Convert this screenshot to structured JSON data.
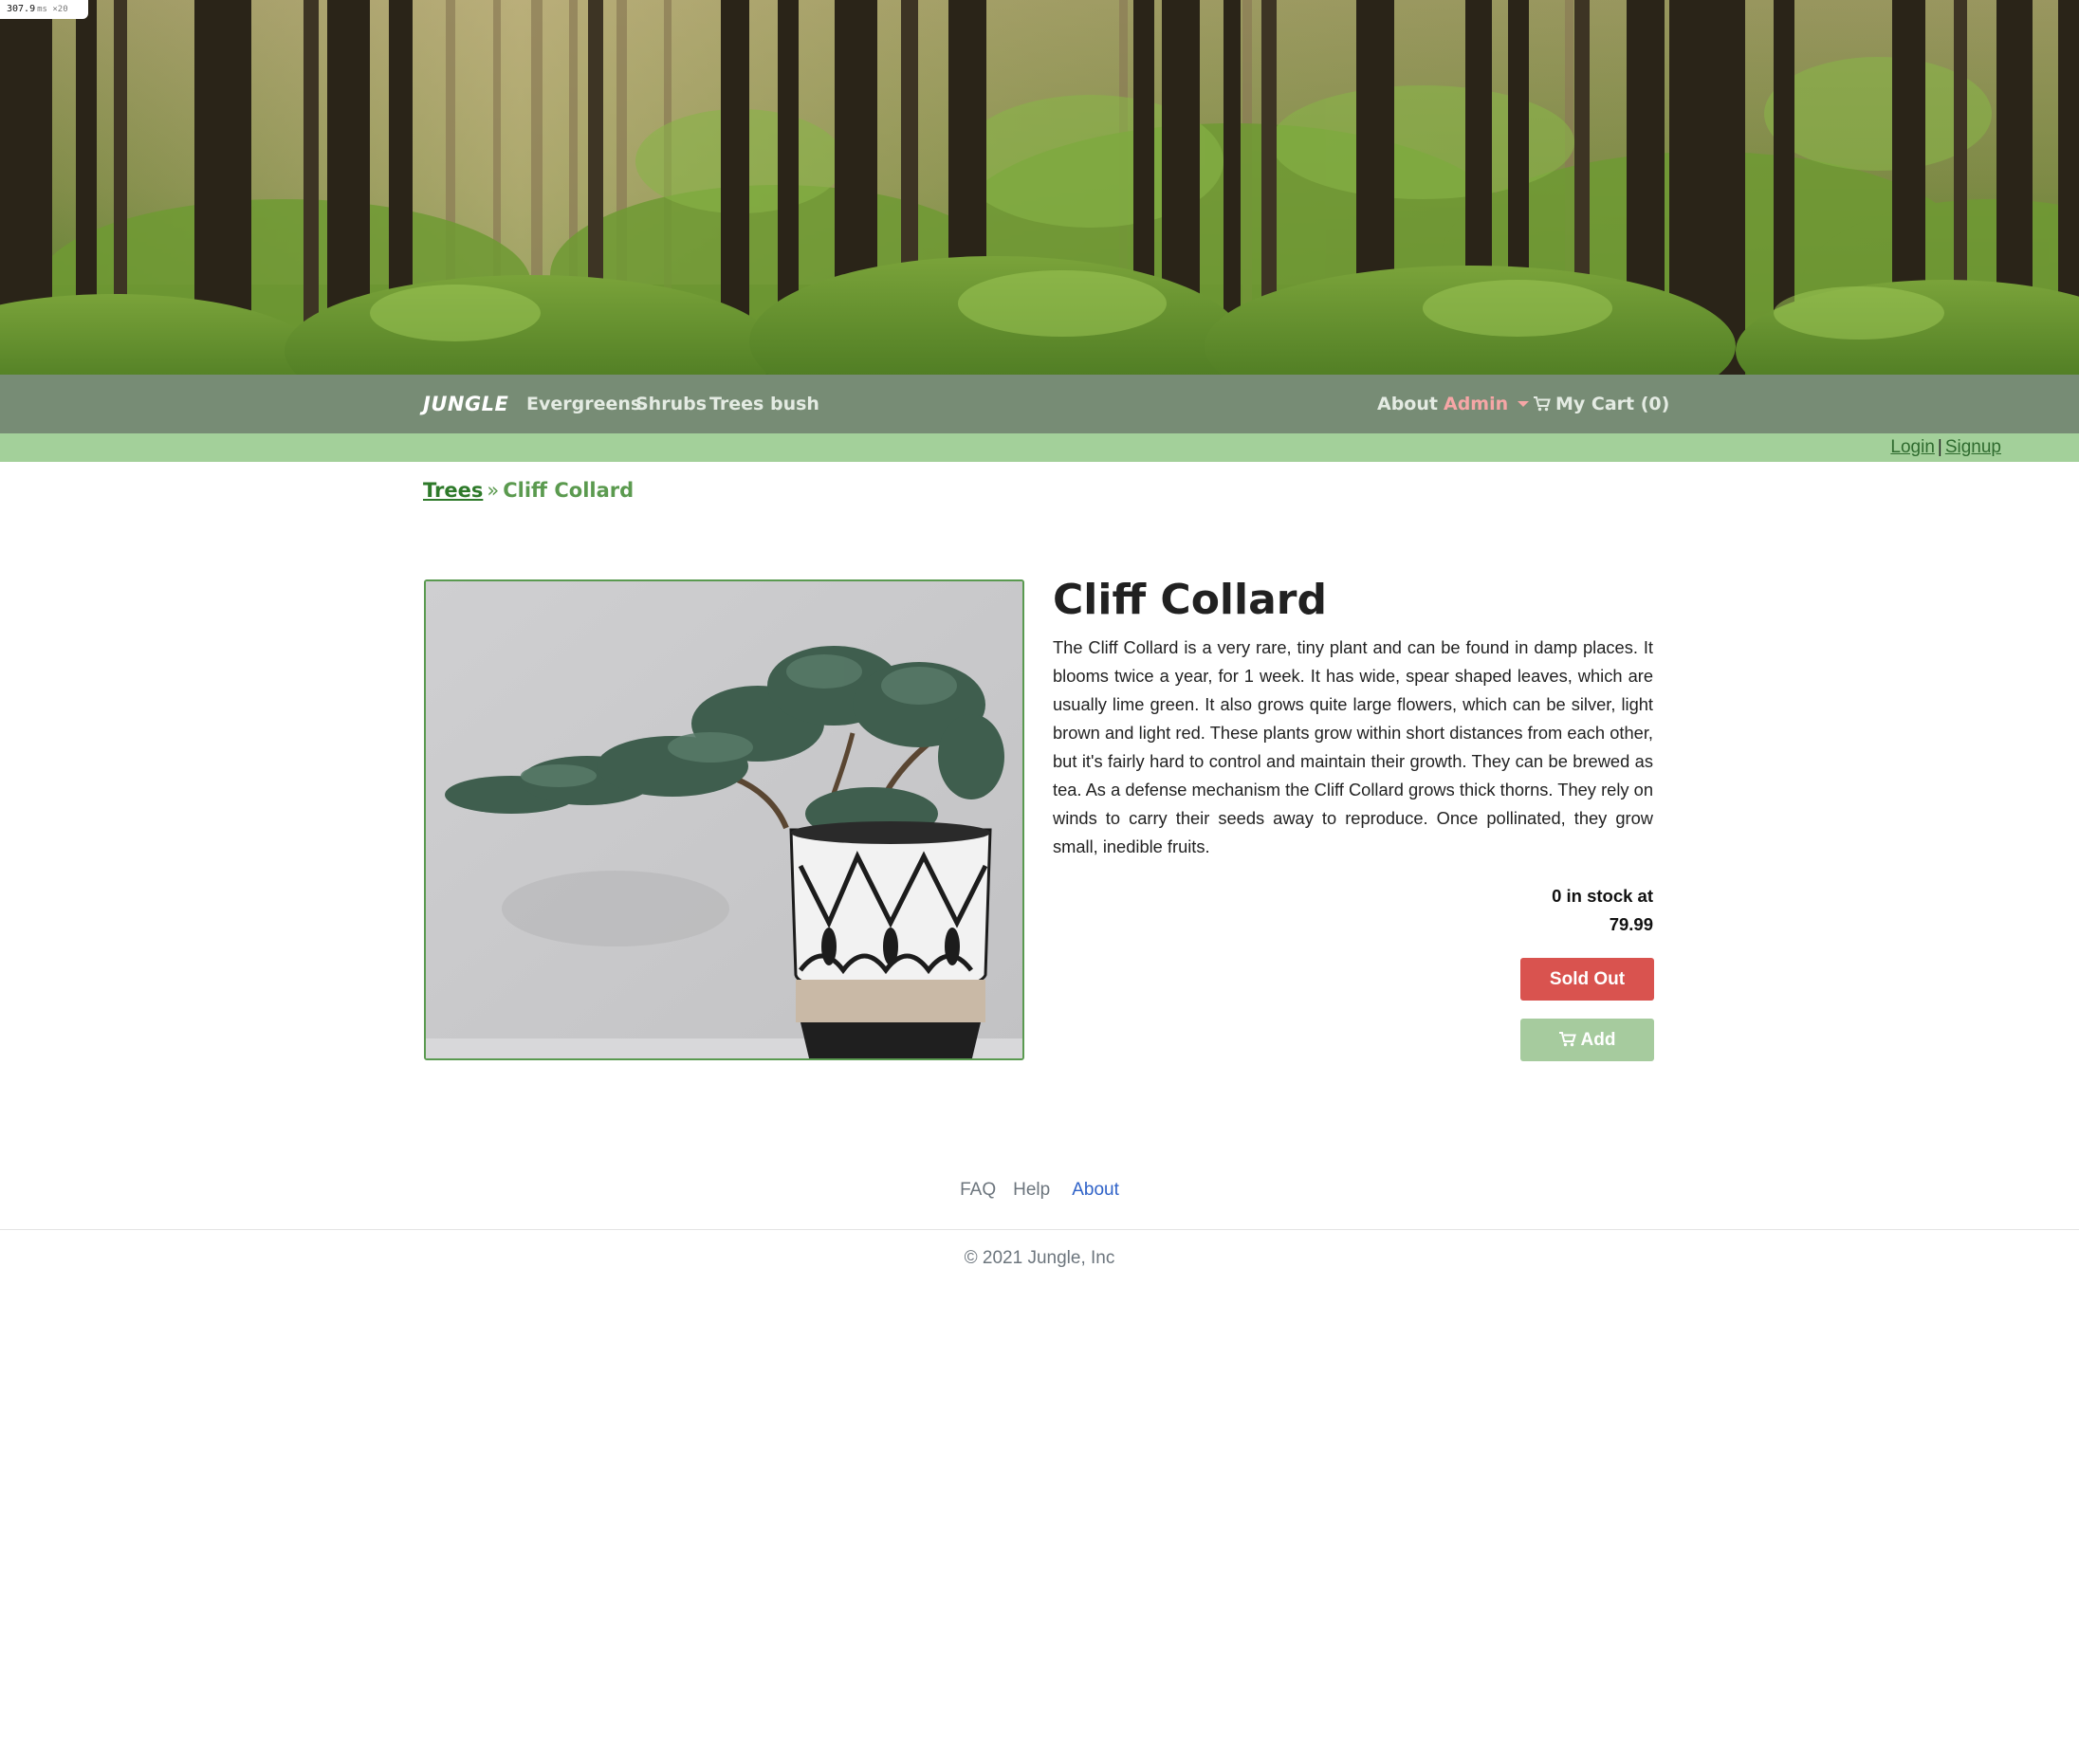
{
  "perf_badge": {
    "value": "307.9",
    "unit": "ms ×20"
  },
  "navbar": {
    "brand": "JUNGLE",
    "categories": [
      "Evergreens",
      "Shrubs",
      "Trees",
      "bush"
    ],
    "about": "About",
    "admin": "Admin",
    "cart": "My Cart (0)"
  },
  "auth": {
    "login": "Login",
    "separator": "|",
    "signup": "Signup"
  },
  "breadcrumb": {
    "parent": "Trees",
    "separator": "»",
    "current": "Cliff Collard"
  },
  "product": {
    "name": "Cliff Collard",
    "description": "The Cliff Collard is a very rare, tiny plant and can be found in damp places. It blooms twice a year, for 1 week. It has wide, spear shaped leaves, which are usually lime green. It also grows quite large flowers, which can be silver, light brown and light red. These plants grow within short distances from each other, but it's fairly hard to control and maintain their growth. They can be brewed as tea. As a defense mechanism the Cliff Collard grows thick thorns. They rely on winds to carry their seeds away to reproduce. Once pollinated, they grow small, inedible fruits.",
    "stock_text": "0 in stock at",
    "price": "79.99",
    "sold_out_label": "Sold Out",
    "add_label": "Add"
  },
  "footer": {
    "links": [
      "FAQ",
      "Help",
      "About"
    ],
    "copyright": "© 2021 Jungle, Inc"
  },
  "colors": {
    "navbar": "#778c75",
    "authbar": "#a3d09a",
    "sold_out": "#d9534f",
    "add_button": "#a6cb9e",
    "admin": "#f6a6a6"
  },
  "icons": {
    "cart": "shopping-cart-icon",
    "admin_dropdown": "caret-down-icon"
  }
}
